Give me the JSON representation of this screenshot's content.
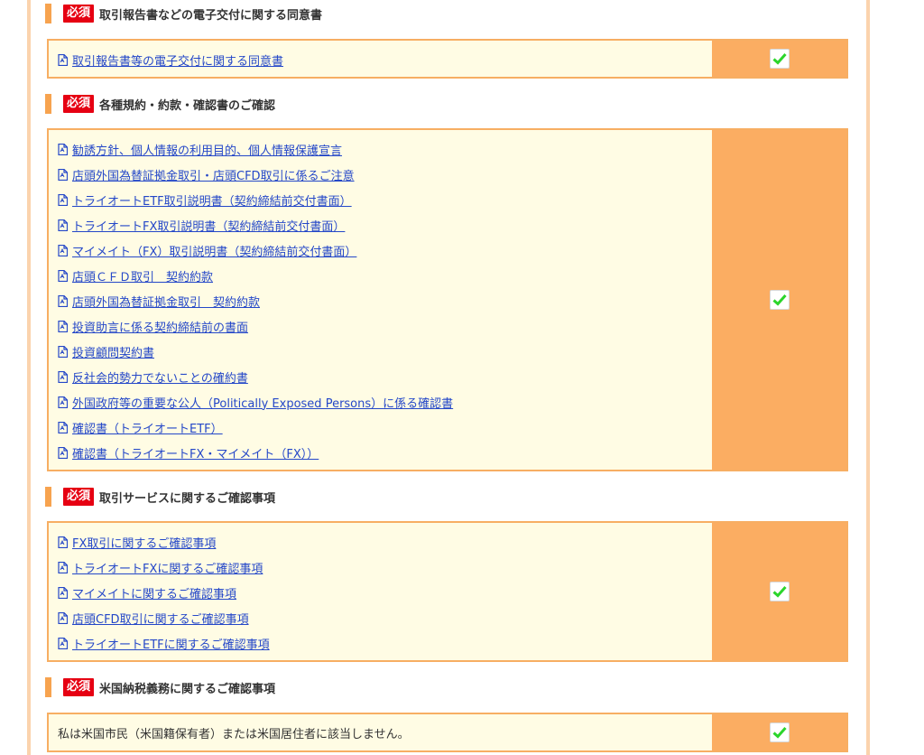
{
  "badge_label": "必須",
  "colors": {
    "accent_orange": "#f7a34f",
    "check_column": "#fbad62",
    "list_background": "#fffce4",
    "badge_red": "#e60012",
    "link_blue": "#2447c8",
    "check_green": "#2bd52b"
  },
  "sections": [
    {
      "title": "取引報告書などの電子交付に関する同意書",
      "checked": true,
      "items": [
        "取引報告書等の電子交付に関する同意書"
      ]
    },
    {
      "title": "各種規約・約款・確認書のご確認",
      "checked": true,
      "items": [
        "勧誘方針、個人情報の利用目的、個人情報保護宣言",
        "店頭外国為替証拠金取引・店頭CFD取引に係るご注意",
        "トライオートETF取引説明書（契約締結前交付書面）",
        "トライオートFX取引説明書（契約締結前交付書面）",
        "マイメイト（FX）取引説明書（契約締結前交付書面）",
        "店頭ＣＦＤ取引　契約約款",
        "店頭外国為替証拠金取引　契約約款",
        "投資助言に係る契約締結前の書面",
        "投資顧問契約書",
        "反社会的勢力でないことの確約書",
        "外国政府等の重要な公人（Politically Exposed Persons）に係る確認書",
        "確認書（トライオートETF）",
        "確認書（トライオートFX・マイメイト（FX））"
      ]
    },
    {
      "title": "取引サービスに関するご確認事項",
      "checked": true,
      "items": [
        "FX取引に関するご確認事項",
        "トライオートFXに関するご確認事項",
        "マイメイトに関するご確認事項",
        "店頭CFD取引に関するご確認事項",
        "トライオートETFに関するご確認事項"
      ]
    },
    {
      "title": "米国納税義務に関するご確認事項",
      "checked": true,
      "statement": "私は米国市民（米国籍保有者）または米国居住者に該当しません。"
    }
  ]
}
